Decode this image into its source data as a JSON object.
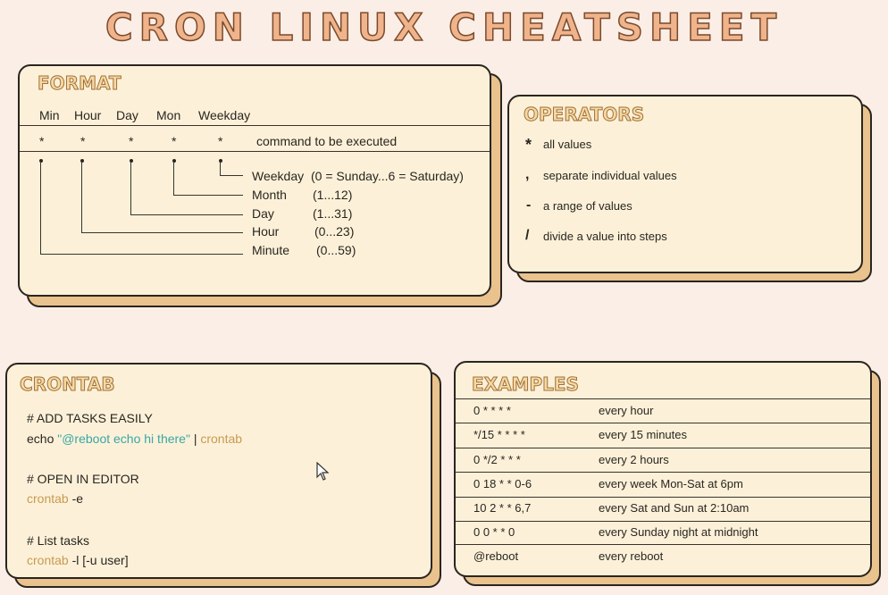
{
  "title": "CRON LINUX CHEATSHEET",
  "format": {
    "heading": "FORMAT",
    "columns": [
      "Min",
      "Hour",
      "Day",
      "Mon",
      "Weekday"
    ],
    "stars": [
      "*",
      "*",
      "*",
      "*",
      "*"
    ],
    "command_label": "command to be executed",
    "fields": [
      {
        "name": "Weekday",
        "range": "(0 = Sunday...6 = Saturday)"
      },
      {
        "name": "Month",
        "range": "(1...12)"
      },
      {
        "name": "Day",
        "range": "(1...31)"
      },
      {
        "name": "Hour",
        "range": "(0...23)"
      },
      {
        "name": "Minute",
        "range": "(0...59)"
      }
    ]
  },
  "operators": {
    "heading": "OPERATORS",
    "items": [
      {
        "symbol": "*",
        "desc": "all values"
      },
      {
        "symbol": ",",
        "desc": "separate individual values"
      },
      {
        "symbol": "-",
        "desc": "a range of values"
      },
      {
        "symbol": "/",
        "desc": "divide a value into steps"
      }
    ]
  },
  "crontab": {
    "heading": "CRONTAB",
    "add_comment": "# ADD TASKS EASILY",
    "add_cmd_echo": "echo",
    "add_cmd_string": "\"@reboot echo hi there\"",
    "add_cmd_pipe": "|",
    "add_cmd_crontab": "crontab",
    "edit_comment": "# OPEN IN EDITOR",
    "edit_cmd_crontab": "crontab",
    "edit_cmd_flag": "-e",
    "list_comment": "# List tasks",
    "list_cmd_crontab": "crontab",
    "list_cmd_flag": "-l [-u user]"
  },
  "examples": {
    "heading": "EXAMPLES",
    "rows": [
      {
        "expr": "0 *  *  *  *",
        "desc": "every hour"
      },
      {
        "expr": "*/15  *  *  *  *",
        "desc": "every 15 minutes"
      },
      {
        "expr": "0 */2  *  *  *",
        "desc": "every 2 hours"
      },
      {
        "expr": "0 18  *  *  0-6",
        "desc": "every week Mon-Sat at 6pm"
      },
      {
        "expr": "10  2  *  *  6,7",
        "desc": "every Sat and Sun at 2:10am"
      },
      {
        "expr": "0 0 *  *  0",
        "desc": "every Sunday night at midnight"
      },
      {
        "expr": "@reboot",
        "desc": "every reboot"
      }
    ]
  },
  "colors": {
    "accent_teal": "#3aa6a6",
    "accent_gold": "#c79a52",
    "card_bg": "#fcf1d8",
    "shadow": "#e9c28d"
  }
}
